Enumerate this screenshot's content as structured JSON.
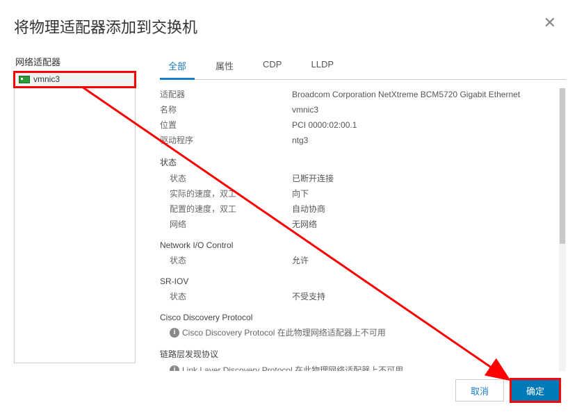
{
  "dialog": {
    "title": "将物理适配器添加到交换机",
    "close_aria": "close"
  },
  "left": {
    "heading": "网络适配器",
    "item": "vmnic3"
  },
  "tabs": {
    "all": "全部",
    "attr": "属性",
    "cdp": "CDP",
    "lldp": "LLDP"
  },
  "props": {
    "adapter_label": "适配器",
    "adapter_value": "Broadcom Corporation NetXtreme BCM5720 Gigabit Ethernet",
    "name_label": "名称",
    "name_value": "vmnic3",
    "location_label": "位置",
    "location_value": "PCI 0000:02:00.1",
    "driver_label": "驱动程序",
    "driver_value": "ntg3",
    "status_section": "状态",
    "status_label": "状态",
    "status_value": "已断开连接",
    "actual_speed_label": "实际的速度，双工",
    "actual_speed_value": "向下",
    "config_speed_label": "配置的速度，双工",
    "config_speed_value": "自动协商",
    "networks_label": "网络",
    "networks_value": "无网络",
    "nioc_section": "Network I/O Control",
    "nioc_status_label": "状态",
    "nioc_status_value": "允许",
    "sriov_section": "SR-IOV",
    "sriov_status_label": "状态",
    "sriov_status_value": "不受支持",
    "cdp_section": "Cisco Discovery Protocol",
    "cdp_info": "Cisco Discovery Protocol 在此物理网络适配器上不可用",
    "lldp_section": "链路层发现协议",
    "lldp_info": "Link Layer Discovery Protocol 在此物理网络适配器上不可用"
  },
  "footer": {
    "cancel": "取消",
    "ok": "确定"
  }
}
